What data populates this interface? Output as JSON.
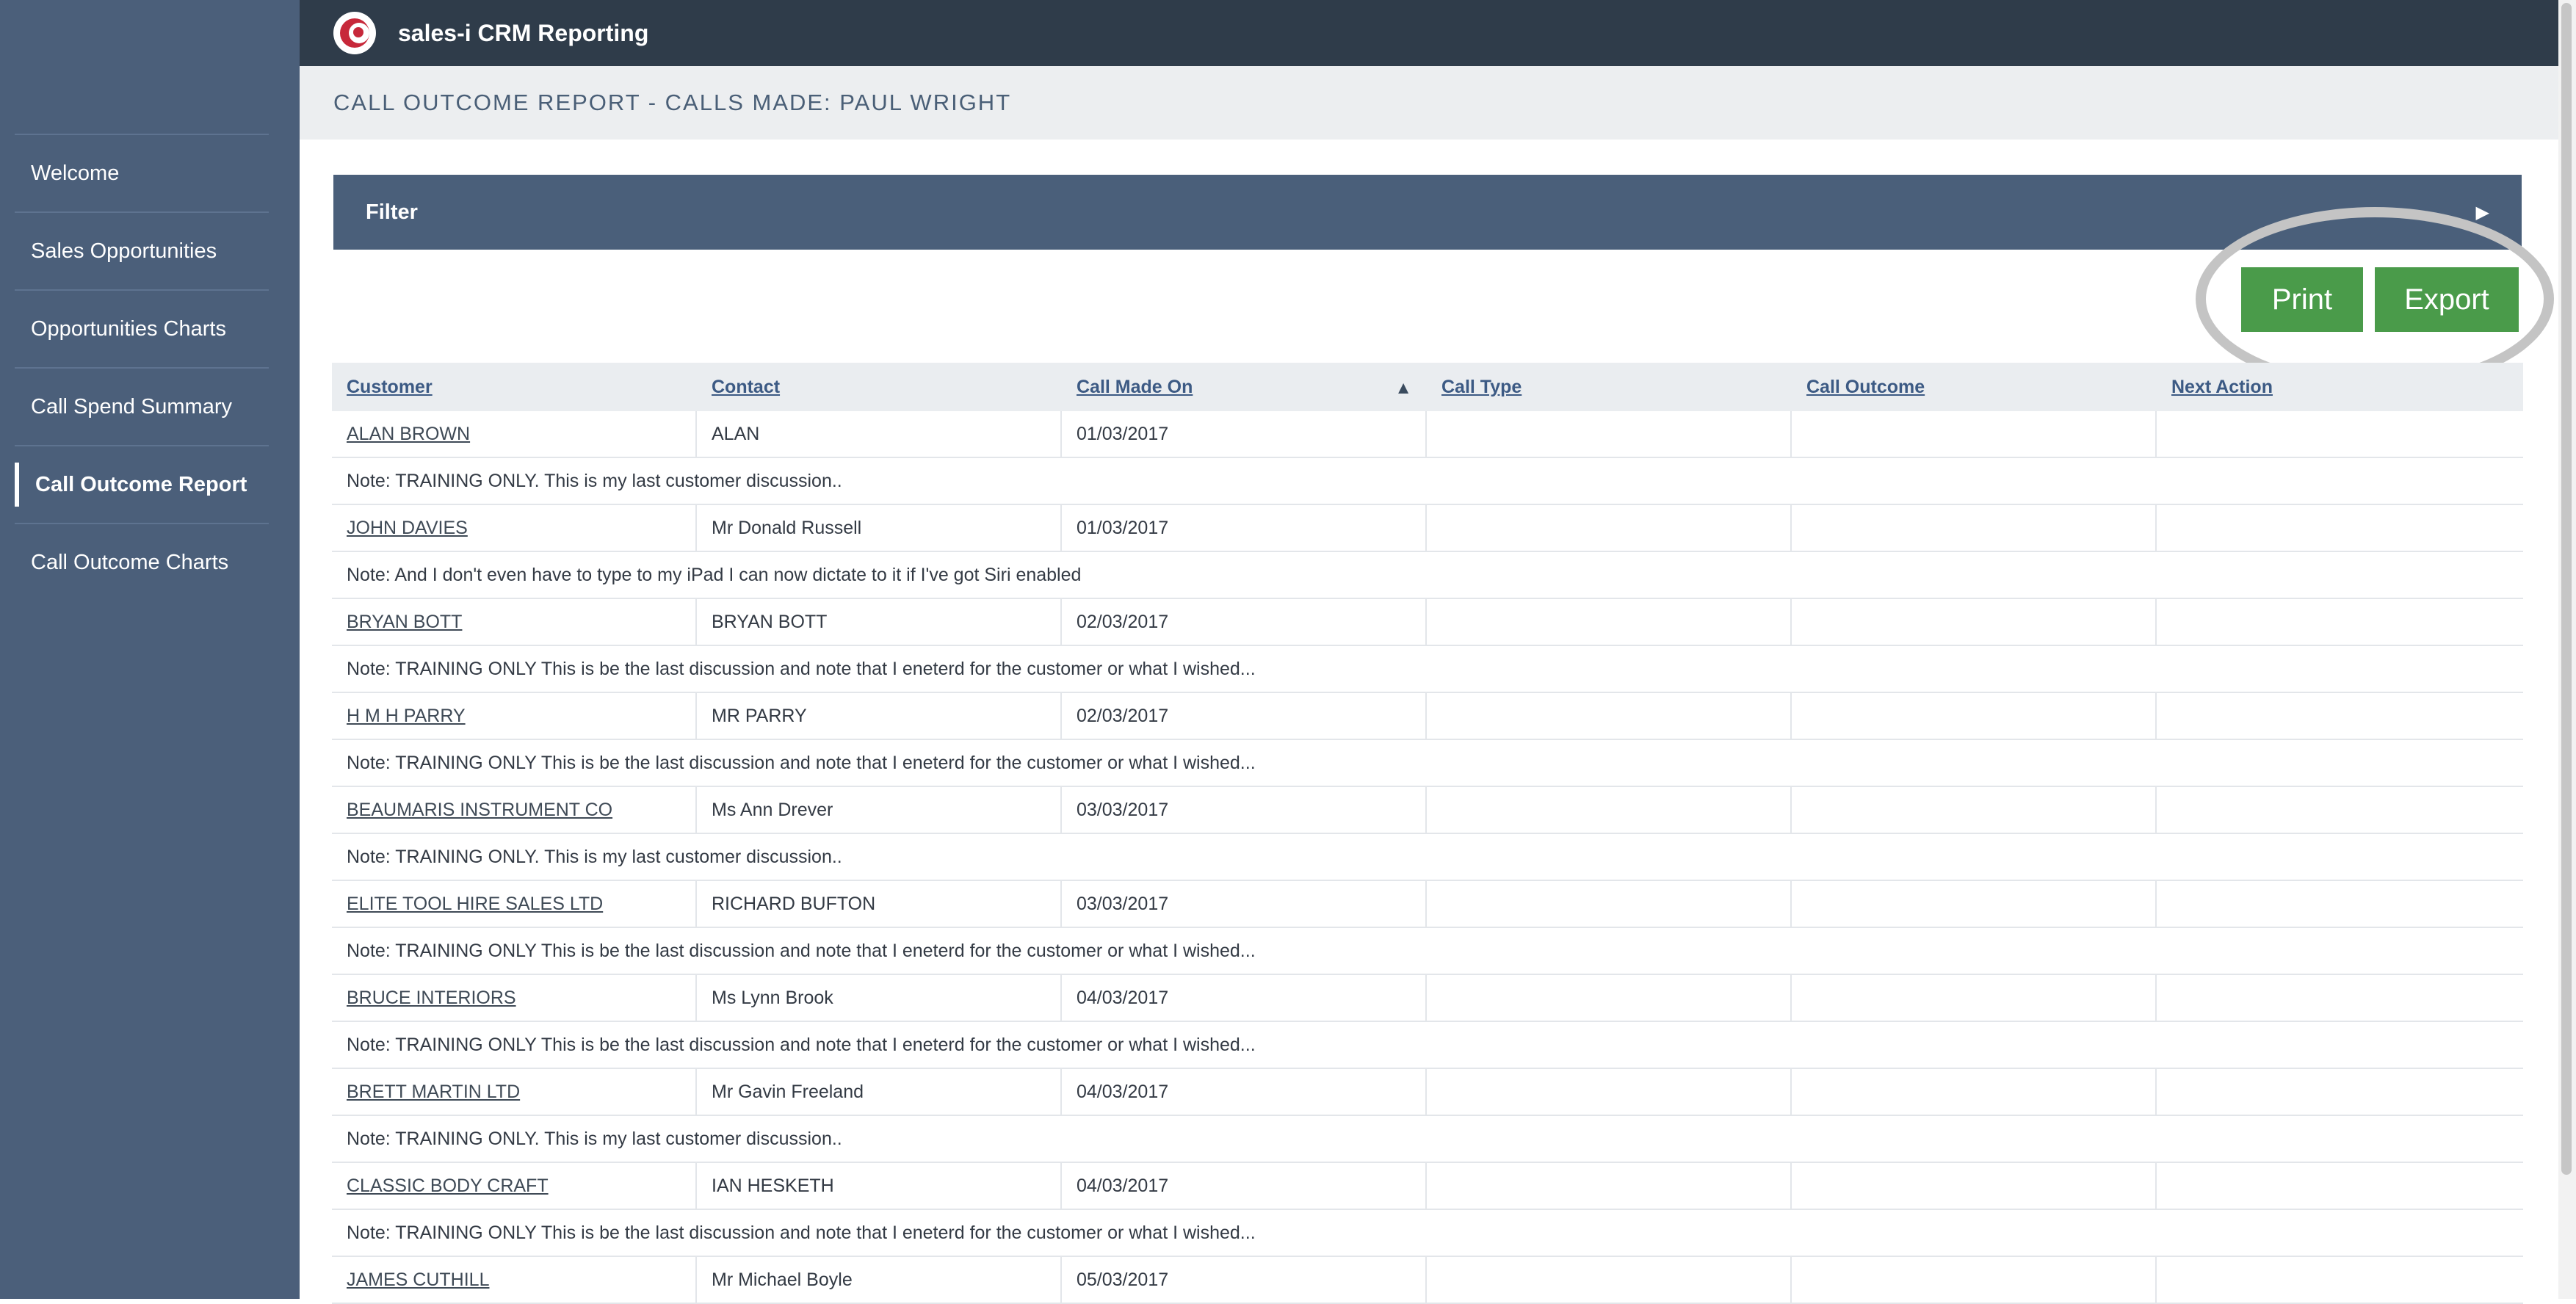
{
  "app": {
    "title": "sales-i CRM Reporting"
  },
  "sidebar": {
    "items": [
      {
        "label": "Welcome",
        "active": false
      },
      {
        "label": "Sales Opportunities",
        "active": false
      },
      {
        "label": "Opportunities Charts",
        "active": false
      },
      {
        "label": "Call Spend Summary",
        "active": false
      },
      {
        "label": "Call Outcome Report",
        "active": true
      },
      {
        "label": "Call Outcome Charts",
        "active": false
      }
    ]
  },
  "page": {
    "title": "CALL OUTCOME REPORT - CALLS MADE: PAUL WRIGHT"
  },
  "filter": {
    "label": "Filter",
    "arrow": "▶"
  },
  "actions": {
    "print_label": "Print",
    "export_label": "Export"
  },
  "table": {
    "headers": [
      "Customer",
      "Contact",
      "Call Made On",
      "Call Type",
      "Call Outcome",
      "Next Action"
    ],
    "sort_indicator": "▲",
    "rows": [
      {
        "customer": "ALAN BROWN",
        "contact": "ALAN",
        "date": "01/03/2017",
        "call_type": "",
        "call_outcome": "",
        "next_action": "",
        "note": "Note: TRAINING ONLY. This is my last customer discussion.."
      },
      {
        "customer": "JOHN DAVIES",
        "contact": "Mr Donald Russell",
        "date": "01/03/2017",
        "call_type": "",
        "call_outcome": "",
        "next_action": "",
        "note": "Note: And I don't even have to type to my iPad I can now dictate to it if I've got Siri enabled"
      },
      {
        "customer": "BRYAN BOTT",
        "contact": "BRYAN BOTT",
        "date": "02/03/2017",
        "call_type": "",
        "call_outcome": "",
        "next_action": "",
        "note": "Note: TRAINING ONLY This is be the last discussion and note that I eneterd for the customer or what I wished..."
      },
      {
        "customer": "H M H PARRY",
        "contact": "MR PARRY",
        "date": "02/03/2017",
        "call_type": "",
        "call_outcome": "",
        "next_action": "",
        "note": "Note: TRAINING ONLY This is be the last discussion and note that I eneterd for the customer or what I wished..."
      },
      {
        "customer": "BEAUMARIS INSTRUMENT CO",
        "contact": "Ms Ann Drever",
        "date": "03/03/2017",
        "call_type": "",
        "call_outcome": "",
        "next_action": "",
        "note": "Note: TRAINING ONLY. This is my last customer discussion.."
      },
      {
        "customer": "ELITE TOOL HIRE SALES LTD",
        "contact": "RICHARD BUFTON",
        "date": "03/03/2017",
        "call_type": "",
        "call_outcome": "",
        "next_action": "",
        "note": "Note: TRAINING ONLY This is be the last discussion and note that I eneterd for the customer or what I wished..."
      },
      {
        "customer": "BRUCE INTERIORS",
        "contact": "Ms Lynn Brook",
        "date": "04/03/2017",
        "call_type": "",
        "call_outcome": "",
        "next_action": "",
        "note": "Note: TRAINING ONLY This is be the last discussion and note that I eneterd for the customer or what I wished..."
      },
      {
        "customer": "BRETT MARTIN LTD",
        "contact": "Mr Gavin Freeland",
        "date": "04/03/2017",
        "call_type": "",
        "call_outcome": "",
        "next_action": "",
        "note": "Note: TRAINING ONLY. This is my last customer discussion.."
      },
      {
        "customer": "CLASSIC BODY CRAFT",
        "contact": "IAN HESKETH",
        "date": "04/03/2017",
        "call_type": "",
        "call_outcome": "",
        "next_action": "",
        "note": "Note: TRAINING ONLY This is be the last discussion and note that I eneterd for the customer or what I wished..."
      },
      {
        "customer": "JAMES CUTHILL",
        "contact": "Mr Michael Boyle",
        "date": "05/03/2017",
        "call_type": "",
        "call_outcome": "",
        "next_action": "",
        "note": null
      }
    ]
  },
  "colors": {
    "sidebar_bg": "#4b5f7a",
    "topbar_bg": "#2f3c4a",
    "filter_bg": "#4a5f7a",
    "button_green": "#4a9b4a",
    "header_link": "#3c5a84",
    "logo_red": "#c7283a"
  }
}
